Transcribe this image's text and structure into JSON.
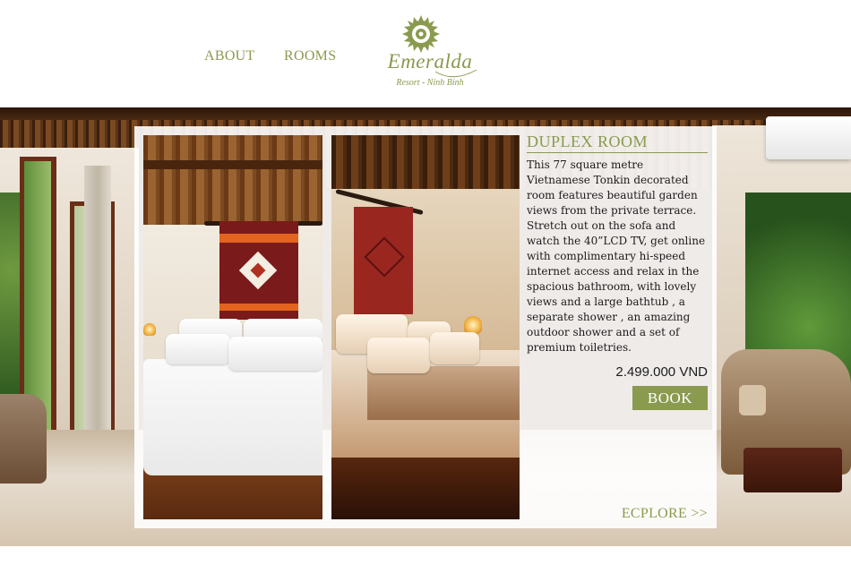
{
  "nav": {
    "about_label": "ABOUT",
    "rooms_label": "ROOMS"
  },
  "logo": {
    "name": "Emeralda",
    "tagline": "Resort - Ninh Binh",
    "icon": "sun-icon"
  },
  "room": {
    "title": "DUPLEX ROOM",
    "description": "This 77 square metre\nVietnamese Tonkin decorated\nroom features beautiful garden\nviews from the private terrace.\nStretch out on the sofa and\nwatch the 40”LCD TV, get online\nwith complimentary hi-speed\ninternet access and relax in  the\nspacious bathroom, with lovely\nviews and  a large bathtub , a\nseparate shower , an amazing\noutdoor shower and a set of\npremium toiletries.",
    "price": "2.499.000 VND",
    "book_label": "BOOK",
    "explore_label": "ECPLORE >>"
  },
  "colors": {
    "accent": "#8a9a4f",
    "text": "#1b1b1b",
    "panel": "#ffffff"
  }
}
